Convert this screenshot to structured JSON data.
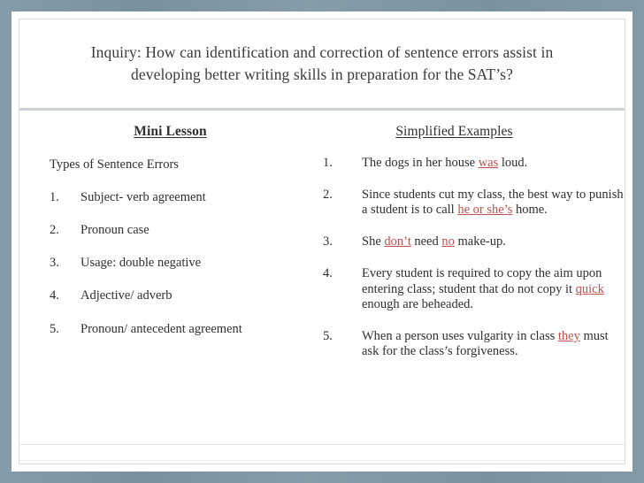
{
  "slide": {
    "title": "Inquiry: How can identification and correction of sentence errors assist in developing better writing skills in preparation for the SAT’s?",
    "colors": {
      "frame": "#7e97a3",
      "canvas": "#ffffff",
      "text": "#2f2f2f",
      "title_text": "#3b3b3b",
      "divider": "#ccd1d6",
      "error_highlight": "#c0504d"
    }
  },
  "left_column": {
    "heading": "Mini Lesson",
    "lead": "Types of Sentence Errors",
    "items": [
      {
        "marker": "1.",
        "text": "Subject- verb agreement"
      },
      {
        "marker": "2.",
        "text": "Pronoun case"
      },
      {
        "marker": "3.",
        "text": "Usage: double negative"
      },
      {
        "marker": "4.",
        "text": "Adjective/ adverb"
      },
      {
        "marker": "5.",
        "text": "Pronoun/ antecedent agreement"
      }
    ]
  },
  "right_column": {
    "heading": "Simplified Examples",
    "items": [
      {
        "marker": "1.",
        "parts": [
          {
            "text": "The dogs in her house ",
            "error": false
          },
          {
            "text": "was",
            "error": true
          },
          {
            "text": " loud.",
            "error": false
          }
        ]
      },
      {
        "marker": "2.",
        "parts": [
          {
            "text": " Since students cut my class, the best way to punish a student is to call ",
            "error": false
          },
          {
            "text": "he or she’s",
            "error": true
          },
          {
            "text": " home.",
            "error": false
          }
        ]
      },
      {
        "marker": "3.",
        "parts": [
          {
            "text": "She ",
            "error": false
          },
          {
            "text": "don’t",
            "error": true
          },
          {
            "text": " need ",
            "error": false
          },
          {
            "text": "no",
            "error": true
          },
          {
            "text": " make-up.",
            "error": false
          }
        ]
      },
      {
        "marker": "4.",
        "parts": [
          {
            "text": "Every student is required to copy the aim upon entering class; student that do not copy it ",
            "error": false
          },
          {
            "text": "quick",
            "error": true
          },
          {
            "text": " enough are beheaded.",
            "error": false
          }
        ]
      },
      {
        "marker": "5.",
        "parts": [
          {
            "text": "When a person uses vulgarity in class ",
            "error": false
          },
          {
            "text": "they",
            "error": true
          },
          {
            "text": " must ask for the class’s forgiveness.",
            "error": false
          }
        ]
      }
    ]
  }
}
